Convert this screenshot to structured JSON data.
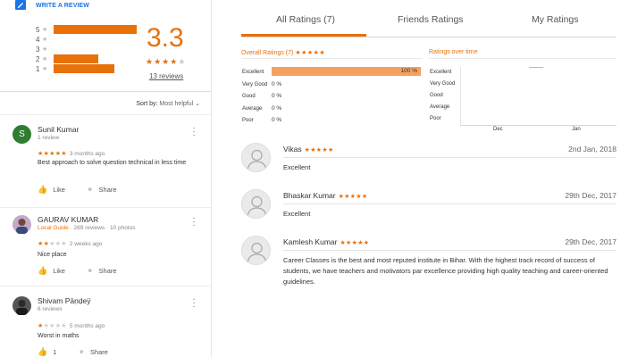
{
  "left": {
    "write_review": "WRITE A REVIEW",
    "histogram": [
      {
        "label": "5",
        "fraction": 0.62
      },
      {
        "label": "4",
        "fraction": 0.0
      },
      {
        "label": "3",
        "fraction": 0.0
      },
      {
        "label": "2",
        "fraction": 0.33
      },
      {
        "label": "1",
        "fraction": 0.45
      }
    ],
    "average": "3.3",
    "average_stars": 3.5,
    "review_count": "13 reviews",
    "sort_label": "Sort by:",
    "sort_value": "Most helpful",
    "reviews": [
      {
        "name": "Sunil Kumar",
        "initial": "S",
        "avatar_color": "#2e7d32",
        "meta": "1 review",
        "rating": 5,
        "ago": "3 months ago",
        "text": "Best approach  to solve question technical  in less time",
        "like": "Like",
        "share": "Share"
      },
      {
        "name": "GAURAV KUMAR",
        "local_guide": "Local Guide",
        "meta": " · 269 reviews · 10 photos",
        "rating": 2,
        "ago": "2 weeks ago",
        "text": "Nice place",
        "like": "Like",
        "share": "Share"
      },
      {
        "name": "Shivam Pāṇḍeÿ",
        "meta": "6 reviews",
        "rating": 1,
        "ago": "5 months ago",
        "text": "Worst in maths",
        "like": "1",
        "share": "Share"
      }
    ]
  },
  "right": {
    "tabs": [
      "All Ratings (7)",
      "Friends Ratings",
      "My Ratings"
    ],
    "overall_title": "Overall Ratings (7)",
    "overall_stars": "★★★★★",
    "over_time_title": "Ratings over time",
    "breakdown": [
      {
        "label": "Excellent",
        "pct": "100 %"
      },
      {
        "label": "Very Good",
        "pct": "0 %"
      },
      {
        "label": "Good",
        "pct": "0 %"
      },
      {
        "label": "Average",
        "pct": "0 %"
      },
      {
        "label": "Poor",
        "pct": "0 %"
      }
    ],
    "over_time_labels": [
      "Excellent",
      "Very Good",
      "Good",
      "Average",
      "Poor"
    ],
    "over_time_ticks": [
      "Dec",
      "Jan"
    ],
    "reviews": [
      {
        "name": "Vikas",
        "stars": "★★★★★",
        "date": "2nd Jan, 2018",
        "text": "Excellent"
      },
      {
        "name": "Bhaskar Kumar",
        "stars": "★★★★★",
        "date": "29th Dec, 2017",
        "text": "Excellent"
      },
      {
        "name": "Kamlesh Kumar",
        "stars": "★★★★★",
        "date": "29th Dec, 2017",
        "text": "Career Classes is the best and most reputed institute in Bihar. With the highest track record of success of students, we have teachers and motivators par excellence providing high quality teaching and career-oriented guidelines."
      }
    ]
  },
  "colors": {
    "accent": "#e8710a",
    "bar_light": "#f5a15f",
    "link": "#1a73e8"
  }
}
